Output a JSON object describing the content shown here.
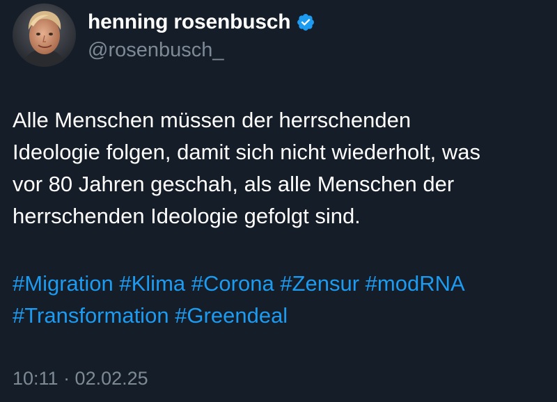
{
  "author": {
    "display_name": "henning rosenbusch",
    "handle": "@rosenbusch_",
    "verified": true,
    "avatar_icon": "profile-photo"
  },
  "tweet": {
    "text_lines": [
      "Alle Menschen müssen der herrschenden",
      "Ideologie folgen, damit sich nicht wiederholt, was",
      "vor 80 Jahren geschah, als alle Menschen der",
      "herrschenden Ideologie gefolgt sind."
    ],
    "hashtags": [
      "#Migration",
      "#Klima",
      "#Corona",
      "#Zensur",
      "#modRNA",
      "#Transformation",
      "#Greendeal"
    ],
    "timestamp": "10:11 · 02.02.25"
  },
  "colors": {
    "background": "#151d28",
    "text": "#ffffff",
    "secondary_text": "#7d8a96",
    "link": "#1d9bf0",
    "verified_badge": "#1d9bf0"
  }
}
